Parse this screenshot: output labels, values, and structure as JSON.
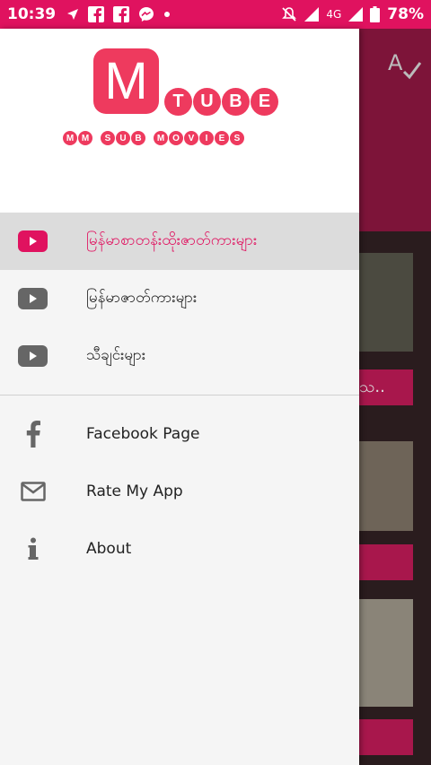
{
  "status_bar": {
    "time": "10:39",
    "network": "4G",
    "battery": "78%"
  },
  "logo": {
    "letter": "M",
    "word": [
      "T",
      "U",
      "B",
      "E"
    ],
    "tagline_words": [
      [
        "M",
        "M"
      ],
      [
        "S",
        "U",
        "B"
      ],
      [
        "M",
        "O",
        "V",
        "I",
        "E",
        "S"
      ]
    ]
  },
  "menu": {
    "video_items": [
      {
        "label": "မြန်မာစာတန်းထိုးဇာတ်ကားများ",
        "icon": "youtube-icon",
        "selected": true
      },
      {
        "label": "မြန်မာဇာတ်ကားများ",
        "icon": "youtube-icon",
        "selected": false
      },
      {
        "label": "သီချင်းများ",
        "icon": "youtube-icon",
        "selected": false
      }
    ],
    "other_items": [
      {
        "label": "Facebook Page",
        "icon": "facebook-icon"
      },
      {
        "label": "Rate My App",
        "icon": "mail-icon"
      },
      {
        "label": "About",
        "icon": "info-icon"
      }
    ]
  },
  "background": {
    "card_text": "သ.."
  },
  "colors": {
    "accent": "#e0125f",
    "logo": "#ee3a5e",
    "icon_gray": "#666666"
  }
}
